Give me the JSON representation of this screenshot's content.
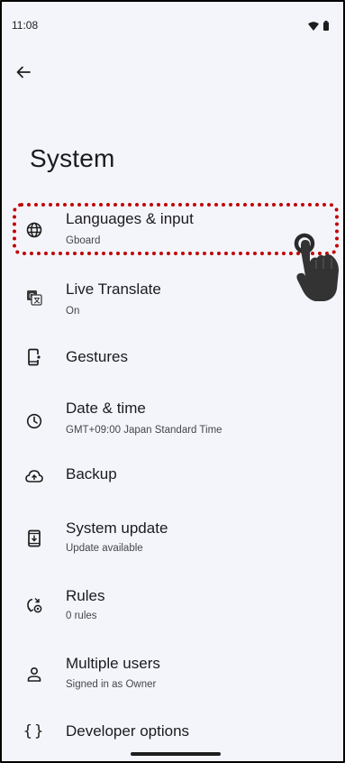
{
  "status_bar": {
    "time": "11:08"
  },
  "page": {
    "title": "System"
  },
  "items": [
    {
      "label": "Languages & input",
      "sub": "Gboard"
    },
    {
      "label": "Live Translate",
      "sub": "On"
    },
    {
      "label": "Gestures"
    },
    {
      "label": "Date & time",
      "sub": "GMT+09:00 Japan Standard Time"
    },
    {
      "label": "Backup"
    },
    {
      "label": "System update",
      "sub": "Update available"
    },
    {
      "label": "Rules",
      "sub": "0 rules"
    },
    {
      "label": "Multiple users",
      "sub": "Signed in as Owner"
    },
    {
      "label": "Developer options"
    }
  ],
  "colors": {
    "highlight": "#c00000",
    "background": "#f4f5fb",
    "text": "#1b1b1f"
  }
}
